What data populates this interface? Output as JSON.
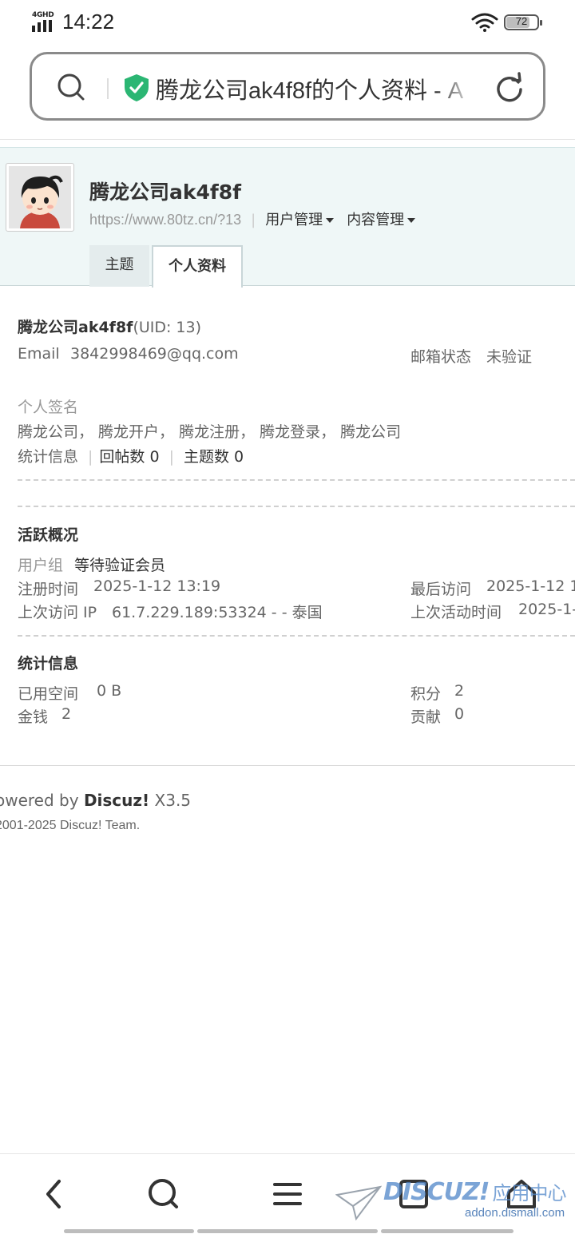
{
  "status_bar": {
    "network": "4GHD",
    "time": "14:22",
    "battery": "72"
  },
  "browser": {
    "url_text": "腾龙公司ak4f8f的个人资料 - A"
  },
  "profile": {
    "display_name": "腾龙公司ak4f8f",
    "space_url": "https://www.80tz.cn/?13",
    "menus": [
      "用户管理",
      "内容管理"
    ],
    "tabs": [
      "主题",
      "个人资料"
    ],
    "active_tab": "个人资料"
  },
  "basic": {
    "name": "腾龙公司ak4f8f",
    "uid": "(UID: 13)",
    "email_label": "Email",
    "email": "3842998469@qq.com",
    "email_status_label": "邮箱状态",
    "email_status": "未验证",
    "signature_label": "个人签名",
    "signature": "腾龙公司， 腾龙开户， 腾龙注册， 腾龙登录， 腾龙公司",
    "stats_label": "统计信息",
    "posts": "回帖数 0",
    "threads": "主题数 0"
  },
  "activity": {
    "heading": "活跃概况",
    "group_label": "用户组",
    "group": "等待验证会员",
    "reg_label": "注册时间",
    "reg": "2025-1-12 13:19",
    "last_visit_label": "最后访问",
    "last_visit": "2025-1-12 1",
    "ip_label": "上次访问 IP",
    "ip": "61.7.229.189:53324 - - 泰国",
    "last_active_label": "上次活动时间",
    "last_active": "2025-1-"
  },
  "stats": {
    "heading": "统计信息",
    "space_label": "已用空间",
    "space": "0 B",
    "points_label": "积分",
    "points": "2",
    "money_label": "金钱",
    "money": "2",
    "contrib_label": "贡献",
    "contrib": "0"
  },
  "footer": {
    "powered_prefix": "owered by",
    "powered_brand": "Discuz!",
    "powered_version": "X3.5",
    "copyright": "2001-2025 Discuz! Team."
  },
  "watermark": {
    "logo": "DISCUZ!",
    "logo_cn": "应用中心",
    "sub": "addon.dismall.com"
  },
  "icons": {
    "search": "search-icon",
    "shield": "shield-check-icon",
    "reload": "reload-icon",
    "back": "back-icon",
    "menu": "menu-icon",
    "tabs": "tabs-icon",
    "home": "home-icon"
  },
  "colors": {
    "shield": "#2bb673",
    "header_bg": "#eff7f7"
  }
}
